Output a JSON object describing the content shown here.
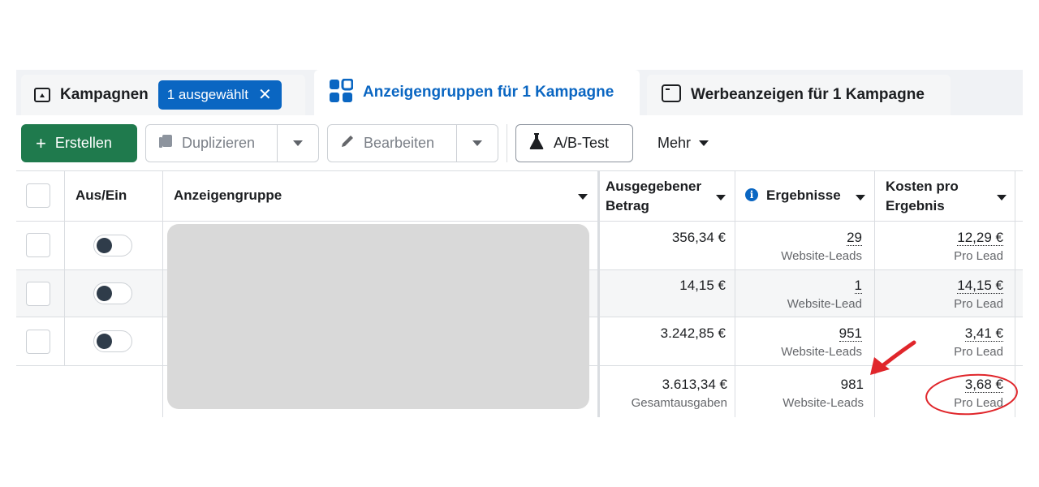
{
  "tabs": {
    "campaigns": {
      "label": "Kampagnen",
      "chip": "1 ausgewählt",
      "chip_close": "✕"
    },
    "adsets": {
      "label": "Anzeigengruppen für 1 Kampagne"
    },
    "ads": {
      "label": "Werbeanzeigen für 1 Kampagne"
    }
  },
  "toolbar": {
    "create_plus": "+",
    "create": "Erstellen",
    "duplicate": "Duplizieren",
    "edit": "Bearbeiten",
    "ab_test": "A/B-Test",
    "more": "Mehr"
  },
  "table": {
    "headers": {
      "onoff": "Aus/Ein",
      "adset": "Anzeigengruppe",
      "spent_line1": "Ausgegebener",
      "spent_line2": "Betrag",
      "results": "Ergebnisse",
      "cost_line1": "Kosten pro",
      "cost_line2": "Ergebnis"
    },
    "rows": [
      {
        "spent": "356,34 €",
        "results": "29",
        "results_sub": "Website-Leads",
        "cost": "12,29 €",
        "cost_sub": "Pro Lead",
        "toggle": "on"
      },
      {
        "spent": "14,15 €",
        "results": "1",
        "results_sub": "Website-Lead",
        "cost": "14,15 €",
        "cost_sub": "Pro Lead",
        "toggle": "on"
      },
      {
        "spent": "3.242,85 €",
        "results": "951",
        "results_sub": "Website-Leads",
        "cost": "3,41 €",
        "cost_sub": "Pro Lead",
        "toggle": "on"
      }
    ],
    "total": {
      "spent": "3.613,34 €",
      "spent_sub": "Gesamtausgaben",
      "results": "981",
      "results_sub": "Website-Leads",
      "cost": "3,68 €",
      "cost_sub": "Pro Lead"
    }
  },
  "colors": {
    "accent": "#0a66c2",
    "create_button": "#1f7a4d",
    "annotation": "#e0262b"
  },
  "icons": [
    "folder-icon",
    "adset-grid-icon",
    "ad-window-icon",
    "duplicate-icon",
    "pencil-icon",
    "flask-icon",
    "info-icon",
    "chevron-down-icon"
  ]
}
